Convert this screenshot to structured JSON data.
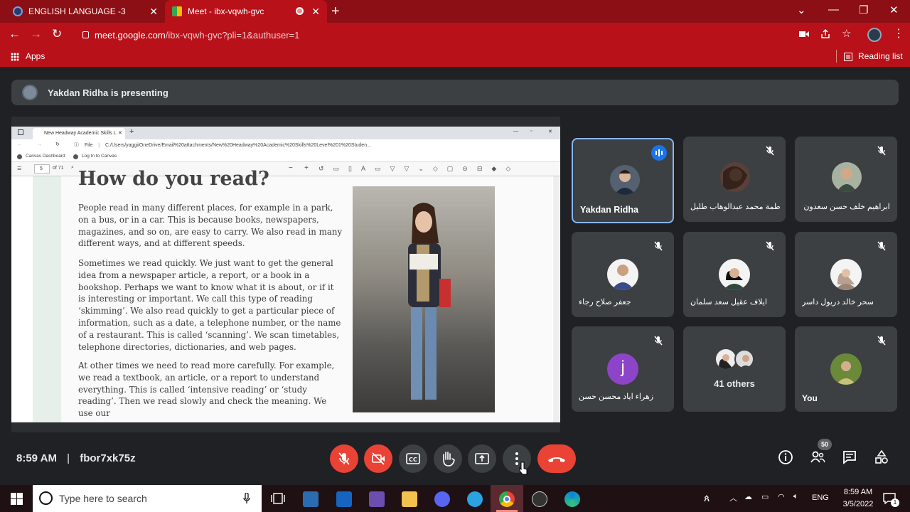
{
  "browser": {
    "tabs": [
      {
        "title": "ENGLISH LANGUAGE -3"
      },
      {
        "title": "Meet - ibx-vqwh-gvc"
      }
    ],
    "url_host": "meet.google.com",
    "url_path": "/ibx-vqwh-gvc?pli=1&authuser=1",
    "bookmarks_apps": "Apps",
    "reading_list": "Reading list"
  },
  "meet": {
    "presenting_text": "Yakdan Ridha is presenting",
    "time": "8:59 AM",
    "separator": "|",
    "meeting_code": "fbor7xk75z",
    "people_count": "50",
    "accent": "#8ab4f8",
    "end_call_color": "#ea4335"
  },
  "shared_screen": {
    "tab_title": "New Headway Academic Skills L",
    "file_label": "File",
    "address": "C:/Users/yaggi/OneDrive/Email%20attachments/New%20Headway%20Academic%20Skills%20Level%201%20Studen...",
    "bookmark_1": "Canvas Dashboard",
    "bookmark_2": "Log In to Canvas",
    "page_number": "5",
    "page_total": "of 71",
    "title": "How do you read?",
    "paragraphs": [
      "People read in many different places, for example in a park, on a bus, or in a car. This is because books, newspapers, magazines, and so on, are easy to carry. We also read in many different ways, and at different speeds.",
      "Sometimes we read quickly. We just want to get the general idea from a newspaper article, a report, or a book in a bookshop. Perhaps we want to know what it is about, or if it is interesting or important. We call this type of reading ‘skimming’. We also read quickly to get a particular piece of information, such as a date, a telephone number, or the name of a restaurant. This is called ‘scanning’. We scan timetables, telephone directories, dictionaries, and web pages.",
      "At other times we need to read more carefully. For example, we read a textbook, an article, or a report to understand everything. This is called ‘intensive reading’ or ‘study reading’. Then we read slowly and check the meaning. We use our"
    ]
  },
  "participants": [
    {
      "name": "Yakdan Ridha",
      "speaking": true,
      "avatar": "photo",
      "color": "#556070"
    },
    {
      "name": "فاطمة محمد عبدالوهاب طليل",
      "muted": true,
      "avatar": "photo",
      "color": "#5a4038"
    },
    {
      "name": "ابراهيم خلف حسن سعدون",
      "muted": true,
      "avatar": "photo",
      "color": "#3d4b3f"
    },
    {
      "name": "جعفر صلاح رجاء",
      "muted": true,
      "avatar": "photo",
      "color": "#3b4a8a"
    },
    {
      "name": "ايلاف عقيل سعد سلمان",
      "muted": true,
      "avatar": "photo",
      "color": "#2f4a3a"
    },
    {
      "name": "سحر خالد دريول داسر",
      "muted": true,
      "avatar": "photo",
      "color": "#b8a090"
    },
    {
      "name": "زهراء اياد محسن حسن",
      "muted": true,
      "avatar": "letter",
      "letter": "j",
      "color": "#8e44c8"
    },
    {
      "name": "41 others",
      "avatar": "group"
    },
    {
      "name": "You",
      "muted": true,
      "avatar": "photo",
      "color": "#6a8a3a"
    }
  ],
  "taskbar": {
    "search_placeholder": "Type here to search",
    "language": "ENG",
    "time": "8:59 AM",
    "date": "3/5/2022",
    "notification_count": "1"
  }
}
